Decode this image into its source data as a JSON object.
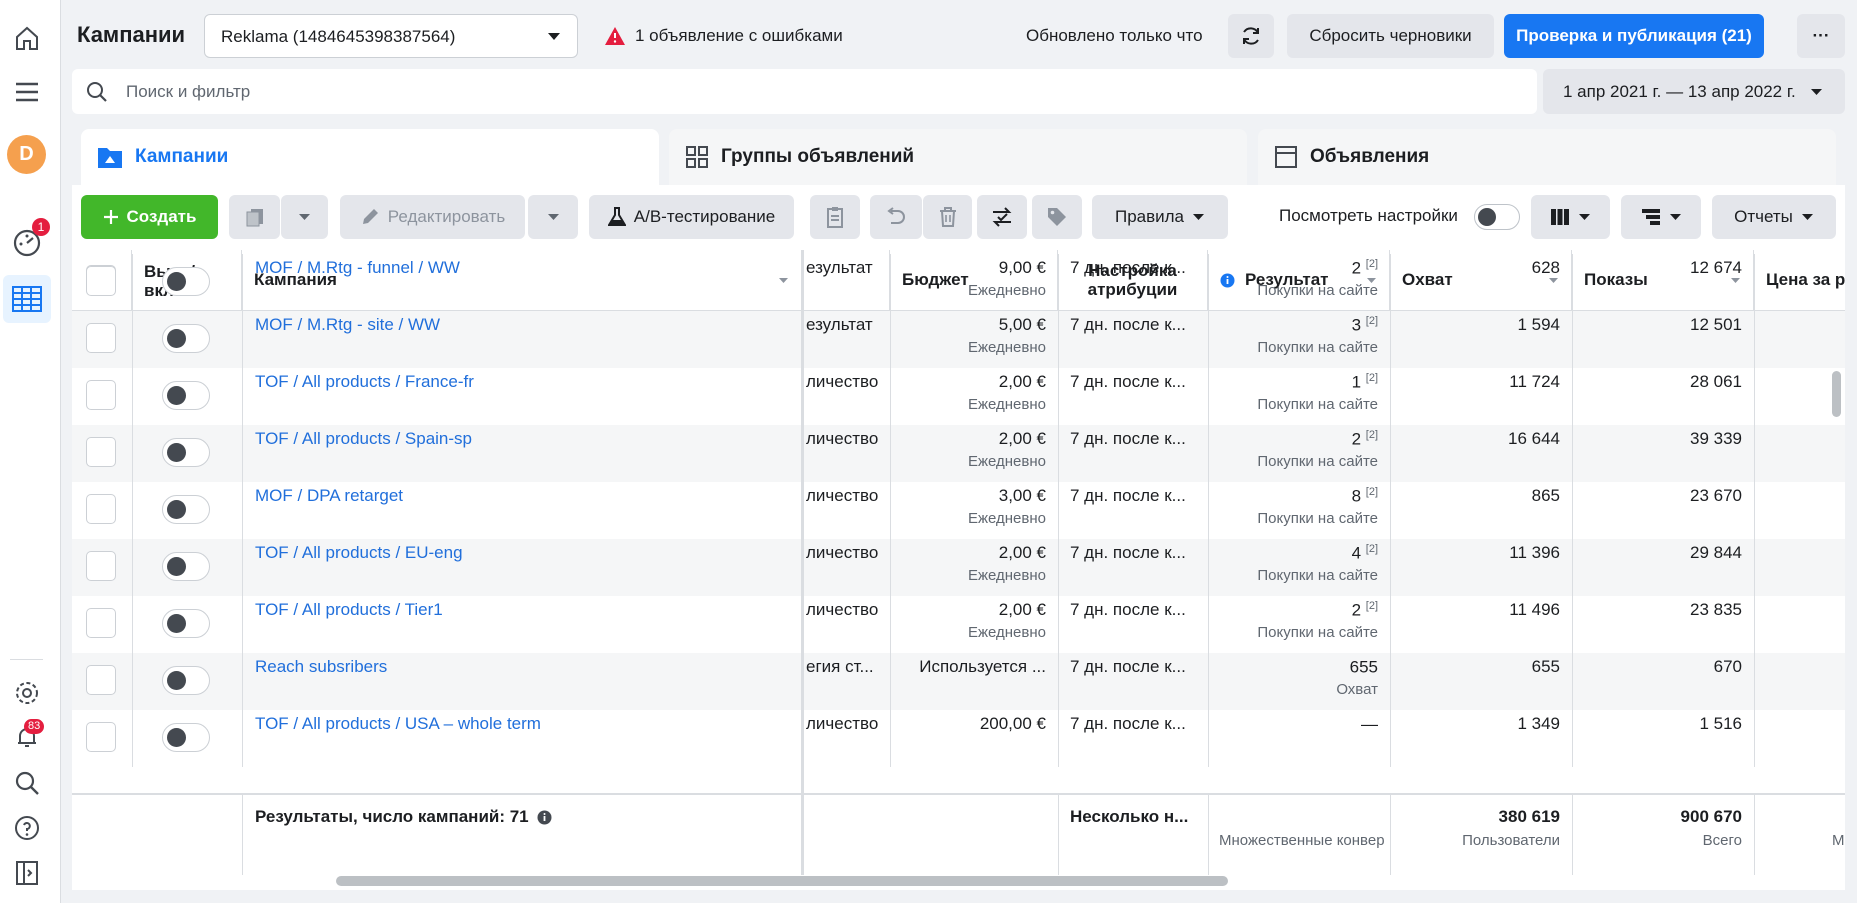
{
  "header": {
    "title": "Кампании",
    "account_selector": "Reklama (1484645398387564)",
    "error_notice": "1 объявление с ошибками",
    "updated_text": "Обновлено только что",
    "discard_drafts": "Сбросить черновики",
    "publish_button": "Проверка и публикация (21)",
    "more_label": "···"
  },
  "search": {
    "placeholder": "Поиск и фильтр"
  },
  "date_range": "1 апр 2021 г. — 13 апр 2022 г.",
  "tabs": [
    {
      "label": "Кампании",
      "active": true
    },
    {
      "label": "Группы объявлений",
      "active": false
    },
    {
      "label": "Объявления",
      "active": false
    }
  ],
  "toolbar": {
    "create": "Создать",
    "edit": "Редактировать",
    "ab_test": "A/B-тестирование",
    "rules": "Правила",
    "view_settings": "Посмотреть настройки",
    "reports": "Отчеты"
  },
  "rail": {
    "avatar_letter": "D",
    "ads_badge": "1",
    "notifications_badge": "83"
  },
  "columns": {
    "onoff": "Выкл/ вкл",
    "campaign": "Кампания",
    "budget": "Бюджет",
    "attribution": "Настройка атрибуции",
    "result": "Результат",
    "reach": "Охват",
    "impressions": "Показы",
    "cost": "Цена за р"
  },
  "rows": [
    {
      "name": "MOF / M.Rtg - funnel / WW",
      "strategy": "езультат",
      "budget": "9,00 €",
      "budget_sub": "Ежедневно",
      "attribution": "7 дн. после к...",
      "result": "2",
      "result_sup": "[2]",
      "result_sub": "Покупки на сайте",
      "reach": "628",
      "impressions": "12 674"
    },
    {
      "name": "MOF / M.Rtg - site / WW",
      "strategy": "езультат",
      "budget": "5,00 €",
      "budget_sub": "Ежедневно",
      "attribution": "7 дн. после к...",
      "result": "3",
      "result_sup": "[2]",
      "result_sub": "Покупки на сайте",
      "reach": "1 594",
      "impressions": "12 501"
    },
    {
      "name": "TOF / All products / France-fr",
      "strategy": "личество",
      "budget": "2,00 €",
      "budget_sub": "Ежедневно",
      "attribution": "7 дн. после к...",
      "result": "1",
      "result_sup": "[2]",
      "result_sub": "Покупки на сайте",
      "reach": "11 724",
      "impressions": "28 061"
    },
    {
      "name": "TOF / All products / Spain-sp",
      "strategy": "личество",
      "budget": "2,00 €",
      "budget_sub": "Ежедневно",
      "attribution": "7 дн. после к...",
      "result": "2",
      "result_sup": "[2]",
      "result_sub": "Покупки на сайте",
      "reach": "16 644",
      "impressions": "39 339"
    },
    {
      "name": "MOF / DPA retarget",
      "strategy": "личество",
      "budget": "3,00 €",
      "budget_sub": "Ежедневно",
      "attribution": "7 дн. после к...",
      "result": "8",
      "result_sup": "[2]",
      "result_sub": "Покупки на сайте",
      "reach": "865",
      "impressions": "23 670"
    },
    {
      "name": "TOF / All products / EU-eng",
      "strategy": "личество",
      "budget": "2,00 €",
      "budget_sub": "Ежедневно",
      "attribution": "7 дн. после к...",
      "result": "4",
      "result_sup": "[2]",
      "result_sub": "Покупки на сайте",
      "reach": "11 396",
      "impressions": "29 844"
    },
    {
      "name": "TOF / All products / Tier1",
      "strategy": "личество",
      "budget": "2,00 €",
      "budget_sub": "Ежедневно",
      "attribution": "7 дн. после к...",
      "result": "2",
      "result_sup": "[2]",
      "result_sub": "Покупки на сайте",
      "reach": "11 496",
      "impressions": "23 835"
    },
    {
      "name": "Reach subsribers",
      "strategy": "егия ст...",
      "budget": "Используется ...",
      "budget_sub": "",
      "attribution": "7 дн. после к...",
      "result": "655",
      "result_sup": "",
      "result_sub": "Охват",
      "reach": "655",
      "impressions": "670"
    },
    {
      "name": "TOF / All products / USA – whole term",
      "strategy": "личество",
      "budget": "200,00 €",
      "budget_sub": "",
      "attribution": "7 дн. после к...",
      "result": "—",
      "result_sup": "",
      "result_sub": "",
      "reach": "1 349",
      "impressions": "1 516"
    }
  ],
  "footer": {
    "summary": "Результаты, число кампаний: 71",
    "attribution": "Несколько н...",
    "result_sub": "Множественные конвер",
    "reach": "380 619",
    "reach_sub": "Пользователи",
    "impressions": "900 670",
    "impressions_sub": "Всего",
    "cost_sub": "М"
  }
}
